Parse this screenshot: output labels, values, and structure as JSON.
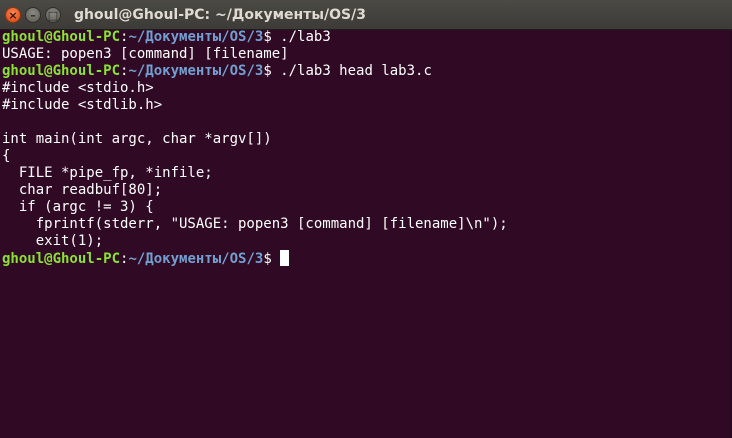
{
  "window": {
    "title": "ghoul@Ghoul-PC: ~/Документы/OS/3",
    "close_glyph": "×",
    "minimize_glyph": "–",
    "maximize_glyph": "□"
  },
  "prompt": {
    "user_host": "ghoul@Ghoul-PC",
    "colon": ":",
    "path": "~/Документы/OS/3",
    "symbol": "$ "
  },
  "lines": [
    {
      "kind": "prompt",
      "command": "./lab3"
    },
    {
      "kind": "output",
      "text": "USAGE: popen3 [command] [filename]"
    },
    {
      "kind": "prompt",
      "command": "./lab3 head lab3.c"
    },
    {
      "kind": "output",
      "text": "#include <stdio.h>"
    },
    {
      "kind": "output",
      "text": "#include <stdlib.h>"
    },
    {
      "kind": "output",
      "text": ""
    },
    {
      "kind": "output",
      "text": "int main(int argc, char *argv[])"
    },
    {
      "kind": "output",
      "text": "{"
    },
    {
      "kind": "output",
      "text": "  FILE *pipe_fp, *infile;"
    },
    {
      "kind": "output",
      "text": "  char readbuf[80];"
    },
    {
      "kind": "output",
      "text": "  if (argc != 3) {"
    },
    {
      "kind": "output",
      "text": "    fprintf(stderr, \"USAGE: popen3 [command] [filename]\\n\");"
    },
    {
      "kind": "output",
      "text": "    exit(1);"
    },
    {
      "kind": "prompt",
      "command": "",
      "cursor": true
    }
  ],
  "colors": {
    "background": "#300a24",
    "prompt_user": "#8ae234",
    "prompt_path": "#729fcf",
    "text": "#ffffff"
  }
}
